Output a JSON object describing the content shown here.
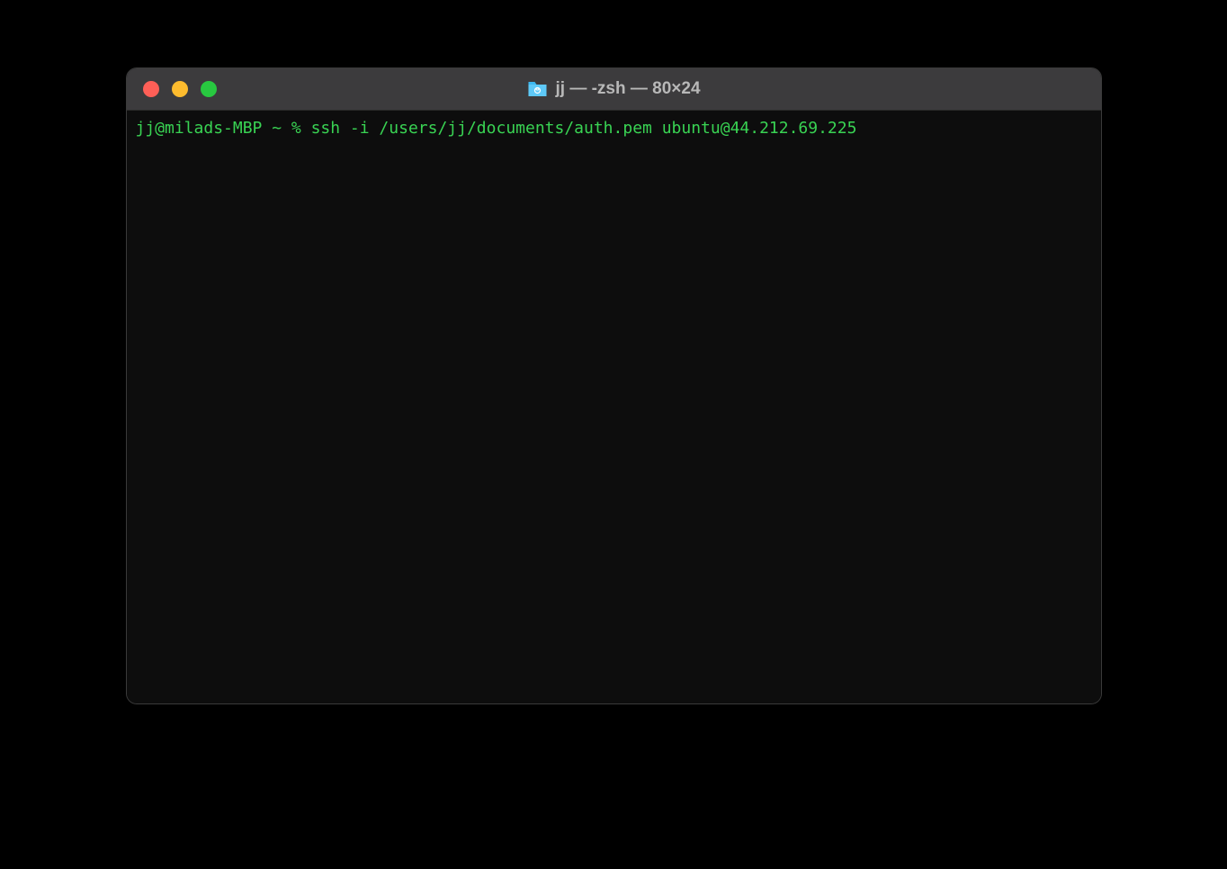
{
  "window": {
    "title": "jj — -zsh — 80×24"
  },
  "terminal": {
    "prompt": "jj@milads-MBP ~ % ",
    "command": "ssh -i /users/jj/documents/auth.pem ubuntu@44.212.69.225"
  }
}
